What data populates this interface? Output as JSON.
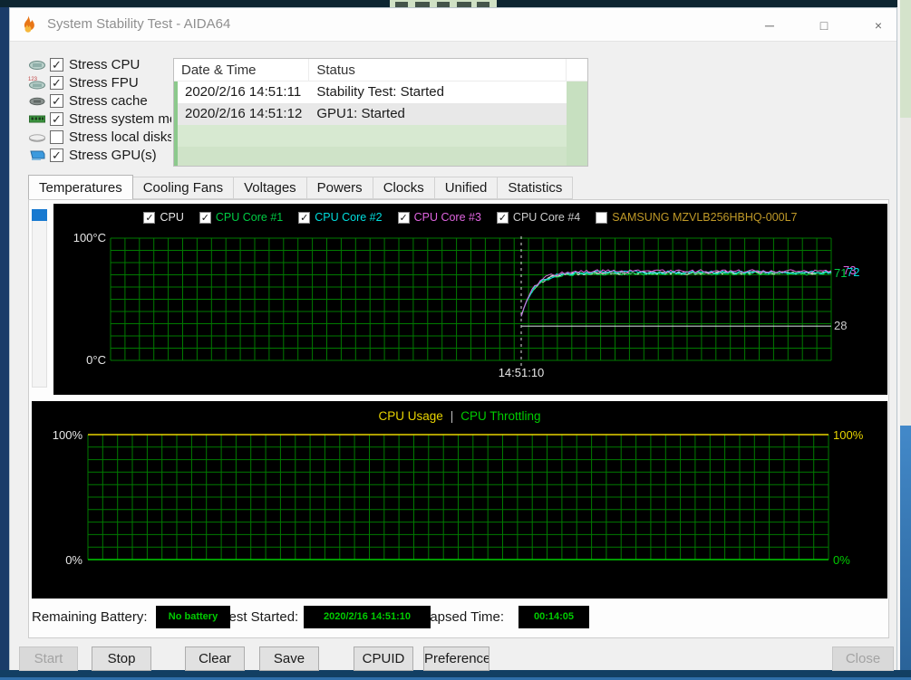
{
  "window": {
    "title": "System Stability Test - AIDA64",
    "controls": {
      "minimize": "─",
      "maximize": "□",
      "close": "×"
    }
  },
  "stress_options": {
    "items": [
      {
        "icon": "cpu-icon",
        "label": "Stress CPU",
        "checked": true
      },
      {
        "icon": "fpu-icon",
        "label": "Stress FPU",
        "checked": true
      },
      {
        "icon": "cache-icon",
        "label": "Stress cache",
        "checked": true
      },
      {
        "icon": "memory-icon",
        "label": "Stress system memory",
        "checked": true
      },
      {
        "icon": "disk-icon",
        "label": "Stress local disks",
        "checked": false
      },
      {
        "icon": "gpu-icon",
        "label": "Stress GPU(s)",
        "checked": true
      }
    ]
  },
  "log": {
    "columns": [
      "Date & Time",
      "Status"
    ],
    "rows": [
      {
        "datetime": "2020/2/16 14:51:11",
        "status": "Stability Test: Started",
        "selected": false
      },
      {
        "datetime": "2020/2/16 14:51:12",
        "status": "GPU1: Started",
        "selected": true
      }
    ],
    "empty_row_count": 3
  },
  "tabs": {
    "items": [
      "Temperatures",
      "Cooling Fans",
      "Voltages",
      "Powers",
      "Clocks",
      "Unified",
      "Statistics"
    ],
    "active": "Temperatures"
  },
  "temperature_chart": {
    "legend": [
      {
        "label": "CPU",
        "color": "#e8e8e8",
        "checked": true
      },
      {
        "label": "CPU Core #1",
        "color": "#00cc44",
        "checked": true
      },
      {
        "label": "CPU Core #2",
        "color": "#00dede",
        "checked": true
      },
      {
        "label": "CPU Core #3",
        "color": "#df64df",
        "checked": true
      },
      {
        "label": "CPU Core #4",
        "color": "#cccccc",
        "checked": true
      },
      {
        "label": "SAMSUNG MZVLB256HBHQ-000L7",
        "color": "#c09a28",
        "checked": false
      }
    ],
    "y_axis": {
      "top": "100°C",
      "bottom": "0°C",
      "min": 0,
      "max": 100
    },
    "x_marker": "14:51:10",
    "grid_color": "#007a00",
    "series": [
      {
        "name": "CPU",
        "color": "#e8e8e8",
        "start": 36,
        "plateau": 71.5
      },
      {
        "name": "CPU Core #4",
        "color": "#cccccc",
        "start": 36,
        "plateau": 71.5
      },
      {
        "name": "CPU Core #1",
        "color": "#00cc44",
        "start": 36,
        "plateau": 71
      },
      {
        "name": "CPU Core #2",
        "color": "#00dede",
        "start": 36,
        "plateau": 72
      },
      {
        "name": "CPU Core #3",
        "color": "#df64df",
        "start": 36,
        "plateau": 73
      }
    ],
    "flat_series": {
      "value": 28,
      "color": "#c4cccc"
    },
    "value_labels": [
      {
        "text": "71",
        "color": "#00cc44"
      },
      {
        "text": "73",
        "color": "#df64df"
      },
      {
        "text": "72",
        "color": "#00dede"
      },
      {
        "text": "28",
        "color": "#cccccc"
      }
    ]
  },
  "usage_chart": {
    "title_left": "CPU Usage",
    "separator": "|",
    "title_right": "CPU Throttling",
    "title_left_color": "#e8d400",
    "separator_color": "#bbbbbb",
    "title_right_color": "#00cc00",
    "left_axis": {
      "top": "100%",
      "bottom": "0%"
    },
    "right_axis": {
      "top": "100%",
      "bottom": "0%",
      "top_color": "#e8d400",
      "bottom_color": "#00cc00"
    },
    "cpu_usage_value": 100,
    "cpu_throttling_value": 0,
    "grid_color": "#007a00"
  },
  "status_bar": {
    "value_color": "#00cc00",
    "fields": [
      {
        "label": "Remaining Battery:",
        "value": "No battery"
      },
      {
        "label": "Test Started:",
        "value": "2020/2/16 14:51:10"
      },
      {
        "label": "Elapsed Time:",
        "value": "00:14:05"
      }
    ]
  },
  "footer_buttons": [
    {
      "label": "Start",
      "enabled": false
    },
    {
      "label": "Stop",
      "enabled": true
    },
    {
      "label": "Clear",
      "enabled": true
    },
    {
      "label": "Save",
      "enabled": true
    },
    {
      "label": "CPUID",
      "enabled": true
    },
    {
      "label": "Preferences",
      "enabled": true
    },
    {
      "label": "Close",
      "enabled": false
    }
  ]
}
